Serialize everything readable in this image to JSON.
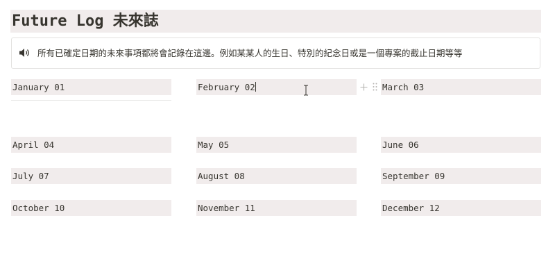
{
  "page": {
    "title": "Future Log 未來誌"
  },
  "callout": {
    "icon": "speaker-icon",
    "text": "所有已確定日期的未來事項都將會記錄在這邊。例如某某人的生日、特別的紀念日或是一個專案的截止日期等等"
  },
  "months": [
    "January 01",
    "February 02",
    "March 03",
    "April 04",
    "May 05",
    "June 06",
    "July 07",
    "August 08",
    "September 09",
    "October 10",
    "November 11",
    "December 12"
  ],
  "icons": {
    "add_block": "plus-icon",
    "drag_handle": "drag-handle-icon",
    "cursor": "text-cursor-icon"
  },
  "colors": {
    "cell_background": "#f1ecec",
    "text": "#37352f",
    "border": "#e3e2e0"
  }
}
